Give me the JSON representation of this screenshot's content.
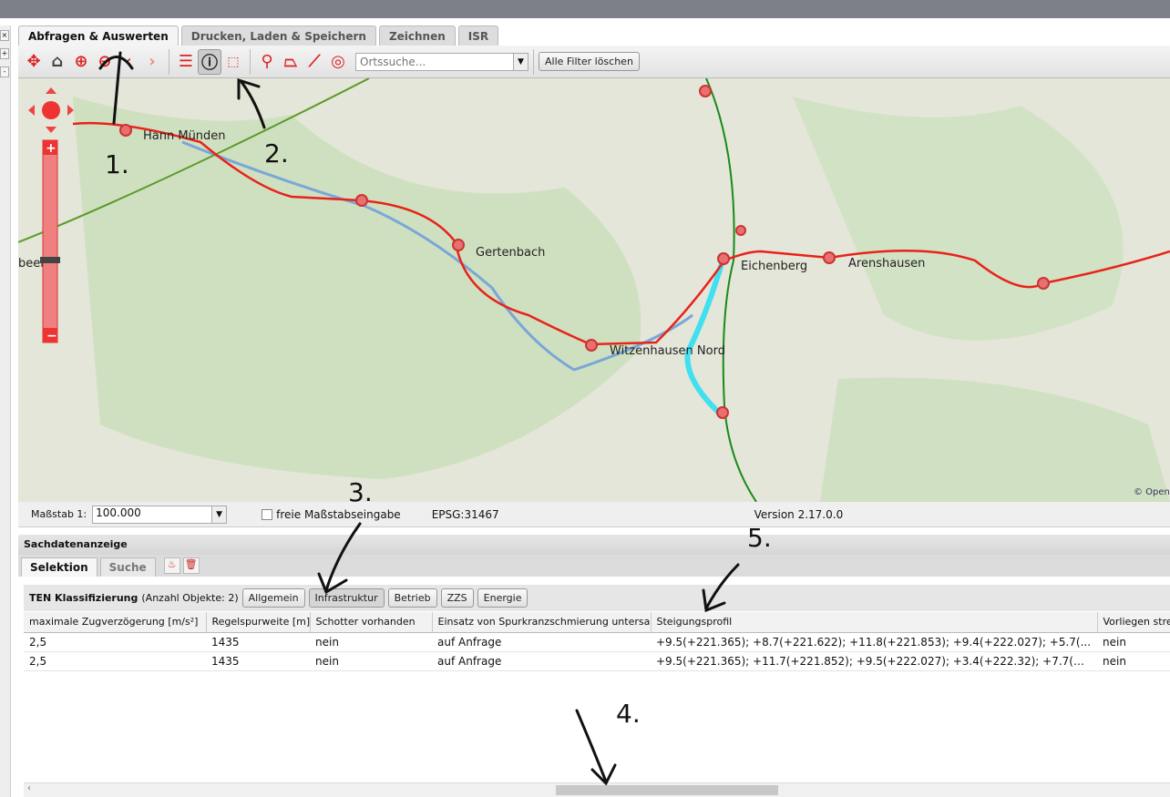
{
  "tabs": [
    {
      "label": "Abfragen & Auswerten",
      "active": true
    },
    {
      "label": "Drucken, Laden & Speichern"
    },
    {
      "label": "Zeichnen"
    },
    {
      "label": "ISR"
    }
  ],
  "toolbar": {
    "search_placeholder": "Ortssuche...",
    "clear_filters": "Alle Filter löschen",
    "icons": [
      "pan-icon",
      "home-icon",
      "zoom-in-icon",
      "zoom-out-icon",
      "back-icon",
      "forward-icon",
      "tooltip-icon",
      "info-icon",
      "select-rectangle-icon",
      "location-search-icon",
      "measure-area-icon",
      "measure-line-icon",
      "measure-radius-icon"
    ]
  },
  "map": {
    "places": [
      "Hann Münden",
      "Gertenbach",
      "Witzenhausen Nord",
      "Eichenberg",
      "Arenshausen"
    ],
    "partial_place": "beele",
    "attribution": "© OpenS",
    "line_color": "#e8231b"
  },
  "scalebar": {
    "label": "Maßstab 1:",
    "value": "100.000",
    "free_label": "freie Maßstabseingabe",
    "epsg": "EPSG:31467",
    "version": "Version 2.17.0.0"
  },
  "panel": {
    "title": "Sachdatenanzeige",
    "tabs": [
      "Selektion",
      "Suche"
    ]
  },
  "group": {
    "title": "TEN Klassifizierung",
    "count": "(Anzahl Objekte: 2)",
    "buttons": [
      "Allgemein",
      "Infrastruktur",
      "Betrieb",
      "ZZS",
      "Energie"
    ],
    "active_button": "Infrastruktur"
  },
  "table": {
    "columns": [
      "maximale Zugverzögerung [m/s²]",
      "Regelspurweite [m]",
      "Schotter vorhanden",
      "Einsatz von Spurkranzschmierung untersagt",
      "Steigungsprofil",
      "Vorliegen stre"
    ],
    "rows": [
      [
        "2,5",
        "1435",
        "nein",
        "auf Anfrage",
        "+9.5(+221.365); +8.7(+221.622); +11.8(+221.853); +9.4(+222.027); +5.7(...",
        "nein"
      ],
      [
        "2,5",
        "1435",
        "nein",
        "auf Anfrage",
        "+9.5(+221.365); +11.7(+221.852); +9.5(+222.027); +3.4(+222.32); +7.7(+...",
        "nein"
      ]
    ]
  },
  "annotations": [
    "1.",
    "2.",
    "3.",
    "4.",
    "5."
  ]
}
